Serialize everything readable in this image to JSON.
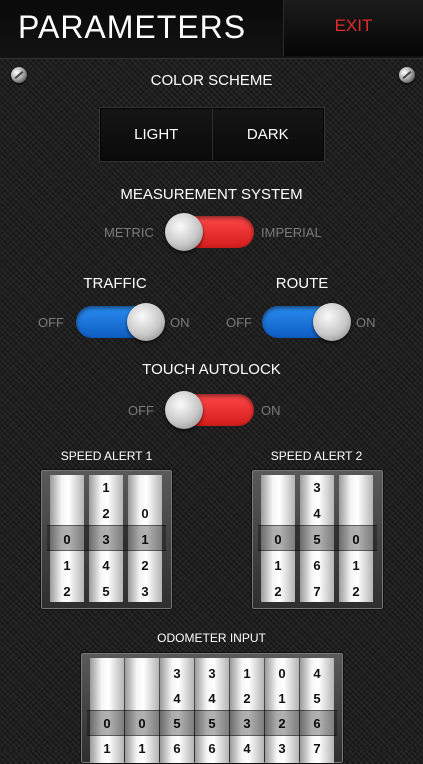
{
  "header": {
    "title": "PARAMETERS",
    "exit_label": "EXIT"
  },
  "color_scheme": {
    "label": "COLOR SCHEME",
    "options": [
      "LIGHT",
      "DARK"
    ]
  },
  "measurement": {
    "label": "MEASUREMENT SYSTEM",
    "left": "METRIC",
    "right": "IMPERIAL",
    "state": "metric"
  },
  "traffic": {
    "label": "TRAFFIC",
    "off": "OFF",
    "on": "ON",
    "state": "on"
  },
  "route": {
    "label": "ROUTE",
    "off": "OFF",
    "on": "ON",
    "state": "on"
  },
  "touch_autolock": {
    "label": "TOUCH AUTOLOCK",
    "off": "OFF",
    "on": "ON",
    "state": "off"
  },
  "speed_alert_1": {
    "label": "SPEED ALERT 1",
    "drums": [
      [
        "",
        "",
        "0",
        "1",
        "2"
      ],
      [
        "1",
        "2",
        "3",
        "4",
        "5"
      ],
      [
        "",
        "0",
        "1",
        "2",
        "3"
      ]
    ]
  },
  "speed_alert_2": {
    "label": "SPEED ALERT 2",
    "drums": [
      [
        "",
        "",
        "0",
        "1",
        "2"
      ],
      [
        "3",
        "4",
        "5",
        "6",
        "7"
      ],
      [
        "",
        "",
        "0",
        "1",
        "2"
      ]
    ]
  },
  "odometer": {
    "label": "ODOMETER INPUT",
    "drums": [
      [
        "",
        "",
        "0",
        "1"
      ],
      [
        "",
        "",
        "0",
        "1"
      ],
      [
        "3",
        "4",
        "5",
        "6"
      ],
      [
        "3",
        "4",
        "5",
        "6"
      ],
      [
        "1",
        "2",
        "3",
        "4"
      ],
      [
        "0",
        "1",
        "2",
        "3"
      ],
      [
        "4",
        "5",
        "6",
        "7"
      ]
    ]
  },
  "colors": {
    "exit": "#e52a2a",
    "toggle_red": "#e82626",
    "toggle_blue": "#1a72d8",
    "background": "#1b1b1b"
  }
}
